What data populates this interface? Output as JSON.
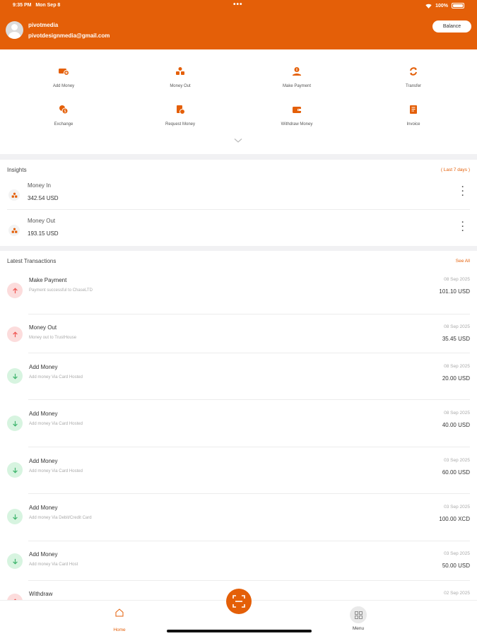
{
  "status_bar": {
    "time": "9:35 PM",
    "date": "Mon Sep 8",
    "dots": "•••",
    "battery": "100%"
  },
  "header": {
    "username": "pivotmedia",
    "email": "pivotdesignmedia@gmail.com",
    "balance_label": "Balance"
  },
  "quick_actions": [
    {
      "label": "Add Money",
      "icon": "add-money-icon"
    },
    {
      "label": "Money Out",
      "icon": "money-out-icon"
    },
    {
      "label": "Make Payment",
      "icon": "make-payment-icon"
    },
    {
      "label": "Transfer",
      "icon": "transfer-icon"
    },
    {
      "label": "Exchange",
      "icon": "exchange-icon"
    },
    {
      "label": "Request Money",
      "icon": "request-money-icon"
    },
    {
      "label": "Withdraw Money",
      "icon": "withdraw-money-icon"
    },
    {
      "label": "Invoice",
      "icon": "invoice-icon"
    }
  ],
  "insights": {
    "title": "Insights",
    "range": "( Last 7 days )",
    "rows": [
      {
        "label": "Money In",
        "amount": "342.54 USD"
      },
      {
        "label": "Money Out",
        "amount": "193.15 USD"
      }
    ]
  },
  "latest": {
    "title": "Latest Transactions",
    "see_all": "See All",
    "items": [
      {
        "title": "Make Payment",
        "desc": "Payment successful to ChaseLTD",
        "date": "08 Sep 2025",
        "amount": "101.10 USD",
        "direction": "up"
      },
      {
        "title": "Money Out",
        "desc": "Money out to TrustHouse",
        "date": "08 Sep 2025",
        "amount": "35.45 USD",
        "direction": "up"
      },
      {
        "title": "Add Money",
        "desc": "Add money Via Card Hosted",
        "date": "08 Sep 2025",
        "amount": "20.00 USD",
        "direction": "down"
      },
      {
        "title": "Add Money",
        "desc": "Add money Via Card Hosted",
        "date": "08 Sep 2025",
        "amount": "40.00 USD",
        "direction": "down"
      },
      {
        "title": "Add Money",
        "desc": "Add money Via Card Hosted",
        "date": "03 Sep 2025",
        "amount": "60.00 USD",
        "direction": "down"
      },
      {
        "title": "Add Money",
        "desc": "Add money Via Debit/Credit Card",
        "date": "03 Sep 2025",
        "amount": "100.00 XCD",
        "direction": "down"
      },
      {
        "title": "Add Money",
        "desc": "Add money Via Card Host",
        "date": "03 Sep 2025",
        "amount": "50.00 USD",
        "direction": "down"
      },
      {
        "title": "Withdraw",
        "desc": "",
        "date": "02 Sep 2025",
        "amount": "",
        "direction": "up"
      }
    ]
  },
  "bottom_nav": {
    "home_label": "Home",
    "menu_label": "Menu"
  },
  "colors": {
    "accent": "#e45f08",
    "up_bg": "#fcdcdc",
    "up_fg": "#ef5350",
    "down_bg": "#d7f4e0",
    "down_fg": "#3cb46b"
  }
}
